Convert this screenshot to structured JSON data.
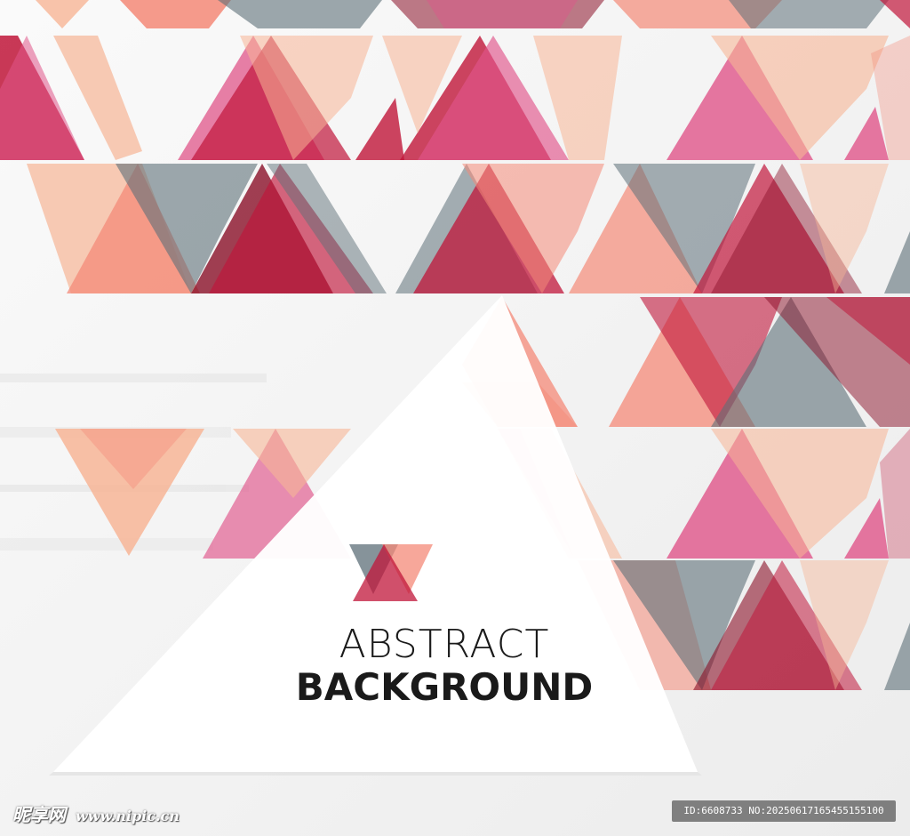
{
  "headline": {
    "line1": "ABSTRACT",
    "line2": "BACKGROUND"
  },
  "watermark": {
    "site": "昵享网",
    "url": "www.nipic.cn"
  },
  "image_id": "ID:6608733 NO:20250617165455155100",
  "colors": {
    "background": "#f4f4f4",
    "crimson": "#c0163a",
    "rose": "#e0558a",
    "salmon": "#f48a78",
    "peach": "#f7b596",
    "slate": "#5d6f78",
    "maroon": "#8a1028"
  }
}
